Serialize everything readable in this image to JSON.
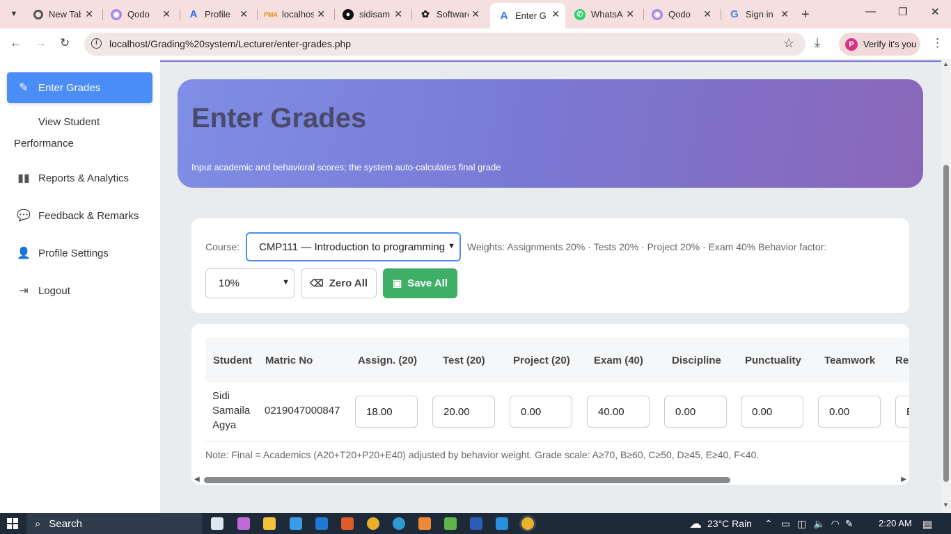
{
  "browser": {
    "tabs": [
      {
        "title": "New Tab",
        "icon": "chrome-icon"
      },
      {
        "title": "Qodo",
        "icon": "qodo-icon"
      },
      {
        "title": "Profile",
        "icon": "a-icon"
      },
      {
        "title": "localhost",
        "icon": "phpmyadmin-icon"
      },
      {
        "title": "sidisam",
        "icon": "github-icon"
      },
      {
        "title": "Software",
        "icon": "openai-icon"
      },
      {
        "title": "Enter G",
        "icon": "a-icon"
      },
      {
        "title": "WhatsA",
        "icon": "whatsapp-icon"
      },
      {
        "title": "Qodo",
        "icon": "qodo-icon"
      },
      {
        "title": "Sign in",
        "icon": "google-icon"
      }
    ],
    "active_tab": 6,
    "url": "localhost/Grading%20system/Lecturer/enter-grades.php",
    "profile_label": "Verify it's you",
    "profile_initial": "P"
  },
  "sidebar": {
    "items": [
      {
        "label": "Enter Grades",
        "icon": "edit-icon"
      },
      {
        "label": "View Student",
        "label_line2": "Performance",
        "icon": ""
      },
      {
        "label": "Reports & Analytics",
        "icon": "bar-chart-icon"
      },
      {
        "label": "Feedback & Remarks",
        "icon": "comments-icon"
      },
      {
        "label": "Profile Settings",
        "icon": "user-cog-icon"
      },
      {
        "label": "Logout",
        "icon": "logout-icon"
      }
    ]
  },
  "hero": {
    "title": "Enter Grades",
    "subtitle": "Input academic and behavioral scores; the system auto-calculates final grade"
  },
  "controls": {
    "course_label": "Course:",
    "course_selected": "CMP111 — Introduction to programming",
    "weights_text": "Weights:  Assignments 20% · Tests 20% · Project 20% · Exam 40%  Behavior factor:",
    "behavior_selected": "10%",
    "zero_label": "Zero All",
    "save_label": "Save All"
  },
  "table": {
    "headers": [
      "Student",
      "Matric No",
      "Assign. (20)",
      "Test (20)",
      "Project (20)",
      "Exam (40)",
      "Discipline",
      "Punctuality",
      "Teamwork",
      "Re"
    ],
    "rows": [
      {
        "student_line1": "Sidi",
        "student_line2": "Samaila",
        "student_line3": "Agya",
        "matric": "0219047000847",
        "assign": "18.00",
        "test": "20.00",
        "project": "0.00",
        "exam": "40.00",
        "discipline": "0.00",
        "punctuality": "0.00",
        "teamwork": "0.00",
        "remark": "E"
      }
    ],
    "note": "Note: Final = Academics (A20+T20+P20+E40) adjusted by behavior weight. Grade scale: A≥70, B≥60, C≥50, D≥45, E≥40, F<40."
  },
  "taskbar": {
    "search_label": "Search",
    "weather": "23°C  Rain",
    "time": "2:20 AM"
  },
  "colors": {
    "accent": "#4a8df6",
    "save_green": "#3fae66",
    "hero_start": "#7f8ee6",
    "hero_end": "#8a66b8"
  }
}
